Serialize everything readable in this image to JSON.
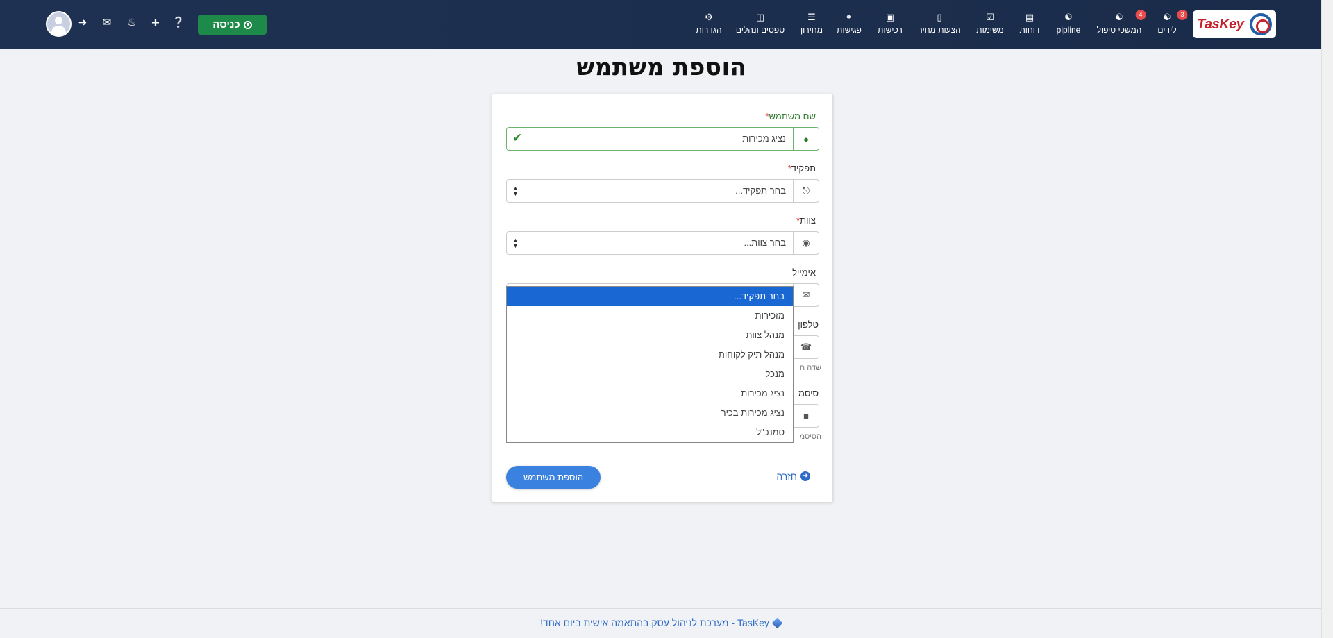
{
  "header": {
    "logo_text": "TasKey",
    "nav": [
      {
        "label": "לידים",
        "icon": "user-icon",
        "badge": "3"
      },
      {
        "label": "המשכי טיפול",
        "icon": "user-icon",
        "badge": "4"
      },
      {
        "label": "pipline",
        "icon": "user-icon",
        "badge": ""
      },
      {
        "label": "דוחות",
        "icon": "bar-chart-icon",
        "badge": ""
      },
      {
        "label": "משימות",
        "icon": "checkbox-icon",
        "badge": ""
      },
      {
        "label": "הצעות מחיר",
        "icon": "document-icon",
        "badge": ""
      },
      {
        "label": "רכישות",
        "icon": "purchase-icon",
        "badge": ""
      },
      {
        "label": "פגישות",
        "icon": "handshake-icon",
        "badge": ""
      },
      {
        "label": "מחירון",
        "icon": "barcode-icon",
        "badge": ""
      },
      {
        "label": "טפסים ונהלים",
        "icon": "book-icon",
        "badge": ""
      },
      {
        "label": "הגדרות",
        "icon": "gear-icon",
        "badge": ""
      }
    ],
    "entry_button": "כניסה",
    "icons": [
      "help-icon",
      "plus-icon",
      "bell-icon",
      "chat-icon",
      "login-icon"
    ]
  },
  "page": {
    "title": "הוספת משתמש"
  },
  "form": {
    "username": {
      "label": "שם משתמש",
      "required": "*",
      "value": "נציג מכירות"
    },
    "role": {
      "label": "תפקיד",
      "required": "*",
      "placeholder": "בחר תפקיד..."
    },
    "team": {
      "label": "צוות",
      "required": "*",
      "placeholder": "בחר צוות..."
    },
    "email": {
      "label": "אימייל"
    },
    "phone": {
      "label": "טלפון",
      "help": "שדה ח"
    },
    "password": {
      "label": "סיסמ",
      "help": "הסיסמ"
    },
    "submit_label": "הוספת משתמש",
    "back_label": "חזרה"
  },
  "role_dropdown": {
    "options": [
      "בחר תפקיד...",
      "מזכירות",
      "מנהל צוות",
      "מנהל תיק לקוחות",
      "מנכל",
      "נציג מכירות",
      "נציג מכירות בכיר",
      "סמנכ\"ל"
    ],
    "selected_index": 0
  },
  "footer": {
    "text": "TasKey - מערכת לניהול עסק בהתאמה אישית ביום אחד!"
  }
}
